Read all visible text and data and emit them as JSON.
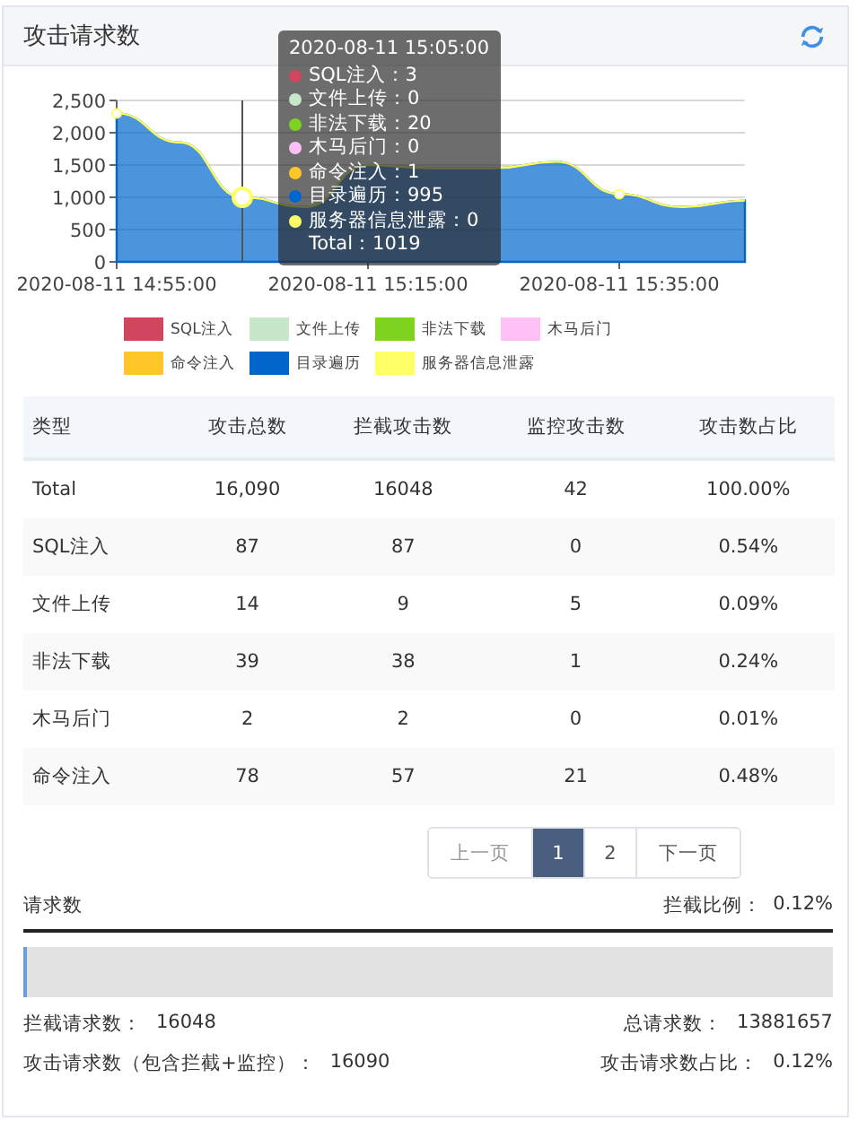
{
  "panel": {
    "title": "攻击请求数"
  },
  "chart": {
    "chart_data": {
      "type": "area",
      "stacked": true,
      "grid": true,
      "legend": true,
      "categories": [
        "2020-08-11 14:55:00",
        null,
        null,
        null,
        "2020-08-11 15:15:00",
        null,
        null,
        null,
        "2020-08-11 15:35:00",
        null,
        null
      ],
      "ylim": [
        0,
        2500
      ],
      "yticks": [
        {
          "value": 0,
          "label": "0"
        },
        {
          "value": 500,
          "label": "500"
        },
        {
          "value": 1000,
          "label": "1,000"
        },
        {
          "value": 1500,
          "label": "1,500"
        },
        {
          "value": 2000,
          "label": "2,000"
        },
        {
          "value": 2500,
          "label": "2,500"
        }
      ],
      "series": [
        {
          "name": "SQL注入",
          "color": "#d0465e",
          "values": [
            null,
            null,
            null,
            null,
            null,
            null,
            null,
            null,
            null,
            null,
            null
          ]
        },
        {
          "name": "文件上传",
          "color": "#c8e6c9",
          "values": [
            null,
            null,
            null,
            null,
            null,
            null,
            null,
            null,
            null,
            null,
            null
          ]
        },
        {
          "name": "非法下载",
          "color": "#7ed321",
          "values": [
            null,
            null,
            null,
            null,
            null,
            null,
            null,
            null,
            null,
            null,
            null
          ]
        },
        {
          "name": "木马后门",
          "color": "#ffc0f5",
          "values": [
            null,
            null,
            null,
            null,
            null,
            null,
            null,
            null,
            null,
            null,
            null
          ]
        },
        {
          "name": "命令注入",
          "color": "#ffc627",
          "values": [
            null,
            null,
            null,
            null,
            null,
            null,
            null,
            null,
            null,
            null,
            null
          ]
        },
        {
          "name": "目录遍历",
          "color": "#0066cc",
          "values": [
            2300,
            1850,
            1000,
            850,
            1500,
            1450,
            1450,
            1550,
            1050,
            850,
            950
          ]
        },
        {
          "name": "服务器信息泄露",
          "color": "#ffff66",
          "values": [
            0,
            0,
            0,
            0,
            0,
            0,
            0,
            0,
            0,
            0,
            0
          ]
        }
      ]
    },
    "tooltip": {
      "title": "2020-08-11 15:05:00",
      "items": [
        {
          "name": "SQL注入：",
          "value": "3",
          "color": "#d0465e"
        },
        {
          "name": "文件上传：",
          "value": "0",
          "color": "#c8e6c9"
        },
        {
          "name": "非法下载：",
          "value": "20",
          "color": "#7ed321"
        },
        {
          "name": "木马后门：",
          "value": "0",
          "color": "#ffc0f5"
        },
        {
          "name": "命令注入：",
          "value": "1",
          "color": "#ffc627"
        },
        {
          "name": "目录遍历：",
          "value": "995",
          "color": "#0066cc"
        },
        {
          "name": "服务器信息泄露：",
          "value": "0",
          "color": "#ffff66"
        }
      ],
      "total_label": "Total：",
      "total": "1019"
    }
  },
  "table": {
    "columns": [
      "类型",
      "攻击总数",
      "拦截攻击数",
      "监控攻击数",
      "攻击数占比"
    ],
    "rows": [
      [
        "Total",
        "16,090",
        "16048",
        "42",
        "100.00%"
      ],
      [
        "SQL注入",
        "87",
        "87",
        "0",
        "0.54%"
      ],
      [
        "文件上传",
        "14",
        "9",
        "5",
        "0.09%"
      ],
      [
        "非法下载",
        "39",
        "38",
        "1",
        "0.24%"
      ],
      [
        "木马后门",
        "2",
        "2",
        "0",
        "0.01%"
      ],
      [
        "命令注入",
        "78",
        "57",
        "21",
        "0.48%"
      ]
    ]
  },
  "pagination": {
    "prev": "上一页",
    "pages": [
      {
        "label": "1",
        "selected": true
      },
      {
        "label": "2",
        "selected": false
      }
    ],
    "next": "下一页"
  },
  "requests": {
    "title": "请求数",
    "ratio_label": "拦截比例：",
    "ratio": "0.12%",
    "level": 0.0012,
    "stats": [
      {
        "label": "拦截请求数：",
        "value": "16048"
      },
      {
        "label": "总请求数：",
        "value": "13881657"
      },
      {
        "label": "攻击请求数（包含拦截+监控）：",
        "value": "16090"
      },
      {
        "label": "攻击请求数占比：",
        "value": "0.12%"
      }
    ]
  }
}
